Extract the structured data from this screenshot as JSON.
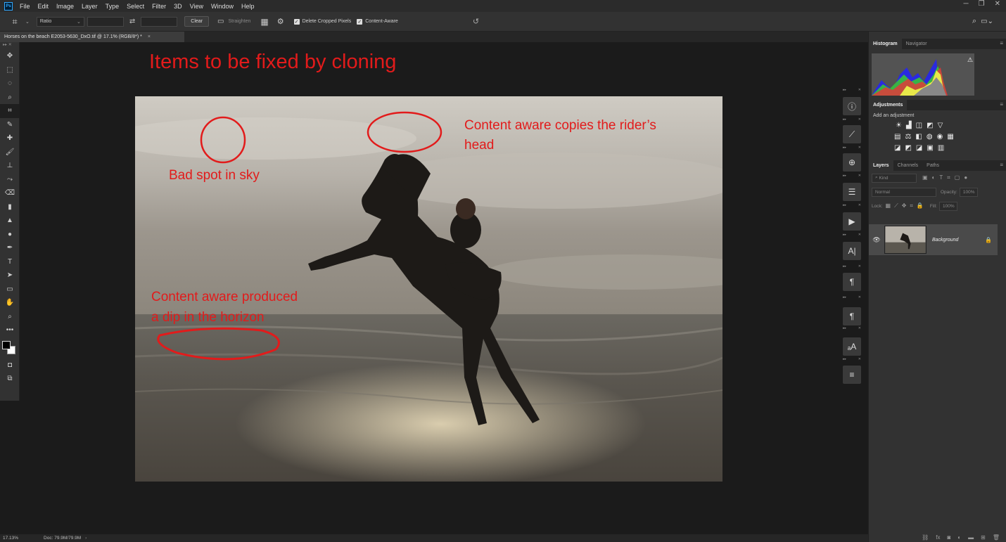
{
  "menubar": {
    "logo": "Ps",
    "items": [
      "File",
      "Edit",
      "Image",
      "Layer",
      "Type",
      "Select",
      "Filter",
      "3D",
      "View",
      "Window",
      "Help"
    ]
  },
  "options": {
    "ratio": "Ratio",
    "clear": "Clear",
    "straighten": "Straighten",
    "delete_cropped": "Delete Cropped Pixels",
    "content_aware": "Content-Aware"
  },
  "document": {
    "tab_title": "Horses on the beach E2053-5630_DxO.tif @ 17.1% (RGB/8*) *",
    "tab_close": "×"
  },
  "annotations": {
    "title": "Items to be fixed by cloning",
    "bad_spot": "Bad spot in sky",
    "head_line1": "Content aware copies the rider’s",
    "head_line2": "head",
    "dip_line1": "Content aware produced",
    "dip_line2": "a dip in the horizon"
  },
  "status": {
    "zoom": "17.13%",
    "doc": "Doc: 79.9M/79.9M"
  },
  "panels": {
    "histogram_tab": "Histogram",
    "navigator_tab": "Navigator",
    "adjustments_tab": "Adjustments",
    "add_adjustment": "Add an adjustment",
    "layers_tab": "Layers",
    "channels_tab": "Channels",
    "paths_tab": "Paths",
    "kind": "Kind",
    "blend_mode": "Normal",
    "opacity_label": "Opacity:",
    "opacity_value": "100%",
    "lock_label": "Lock:",
    "fill_label": "Fill:",
    "fill_value": "100%",
    "layer_name": "Background"
  },
  "colors": {
    "annotation_red": "#e21b1b",
    "ui_dark": "#323232",
    "canvas_bg": "#1b1b1b"
  }
}
